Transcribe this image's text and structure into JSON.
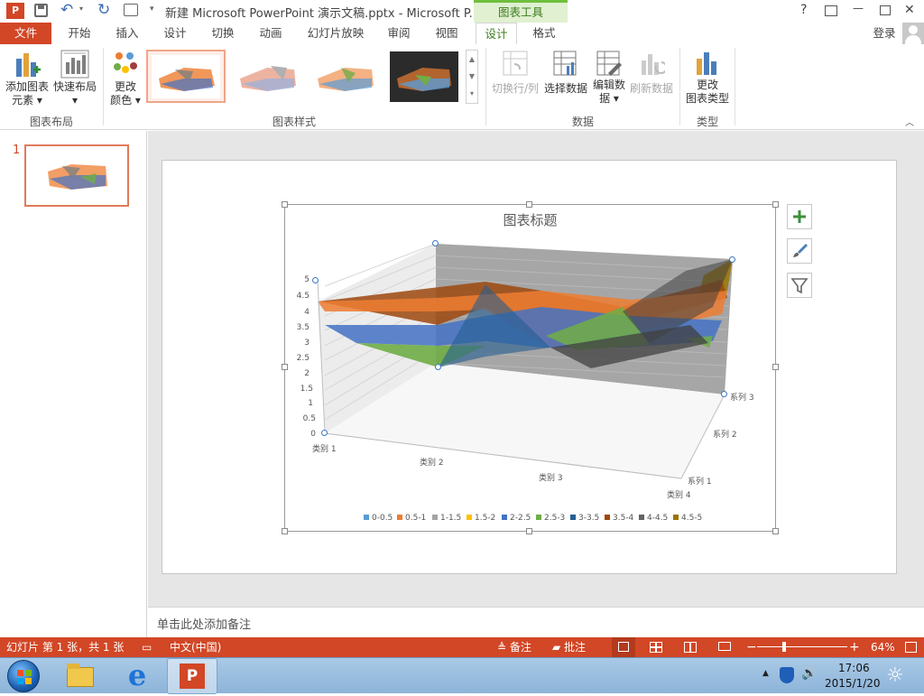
{
  "titlebar": {
    "title": "新建 Microsoft PowerPoint 演示文稿.pptx - Microsoft P...",
    "contextual_group": "图表工具",
    "help": "?",
    "minimize": "—",
    "close": "✕"
  },
  "tabs": {
    "file": "文件",
    "items": [
      "开始",
      "插入",
      "设计",
      "切换",
      "动画",
      "幻灯片放映",
      "审阅",
      "视图"
    ],
    "chart_design": "设计",
    "chart_format": "格式",
    "login": "登录"
  },
  "ribbon": {
    "add_element": [
      "添加图表",
      "元素 ▾"
    ],
    "quick_layout": [
      "快速布局",
      "▾"
    ],
    "group_layout": "图表布局",
    "change_colors": [
      "更改",
      "颜色 ▾"
    ],
    "group_styles": "图表样式",
    "switch_row_col": "切换行/列",
    "select_data": "选择数据",
    "edit_data": [
      "编辑数",
      "据 ▾"
    ],
    "refresh_data": "刷新数据",
    "group_data": "数据",
    "change_type": [
      "更改",
      "图表类型"
    ],
    "group_type": "类型"
  },
  "slides": {
    "number": "1"
  },
  "notes": {
    "placeholder": "单击此处添加备注"
  },
  "chart_data": {
    "type": "surface",
    "title": "图表标题",
    "categories": [
      "类别 1",
      "类别 2",
      "类别 3",
      "类别 4"
    ],
    "series_axis": [
      "系列 1",
      "系列 2",
      "系列 3"
    ],
    "z_ticks": [
      "0",
      "0.5",
      "1",
      "1.5",
      "2",
      "2.5",
      "3",
      "3.5",
      "4",
      "4.5",
      "5"
    ],
    "zlim": [
      0,
      5
    ],
    "series": [
      {
        "name": "系列 1",
        "values": [
          4.3,
          2.5,
          3.5,
          4.5
        ]
      },
      {
        "name": "系列 2",
        "values": [
          2.4,
          4.4,
          1.8,
          2.8
        ]
      },
      {
        "name": "系列 3",
        "values": [
          2,
          2,
          3,
          5
        ]
      }
    ],
    "legend": [
      "0-0.5",
      "0.5-1",
      "1-1.5",
      "1.5-2",
      "2-2.5",
      "2.5-3",
      "3-3.5",
      "3.5-4",
      "4-4.5",
      "4.5-5"
    ],
    "legend_colors": [
      "#5b9bd5",
      "#ed7d31",
      "#a5a5a5",
      "#ffc000",
      "#4472c4",
      "#70ad47",
      "#255e91",
      "#9e480e",
      "#636363",
      "#997300"
    ],
    "legend_position": "bottom"
  },
  "status": {
    "slide_info": "幻灯片 第 1 张，共 1 张",
    "language": "中文(中国)",
    "notes": "备注",
    "comments": "批注",
    "zoom": "64%"
  },
  "taskbar": {
    "time": "17:06",
    "date": "2015/1/20"
  }
}
